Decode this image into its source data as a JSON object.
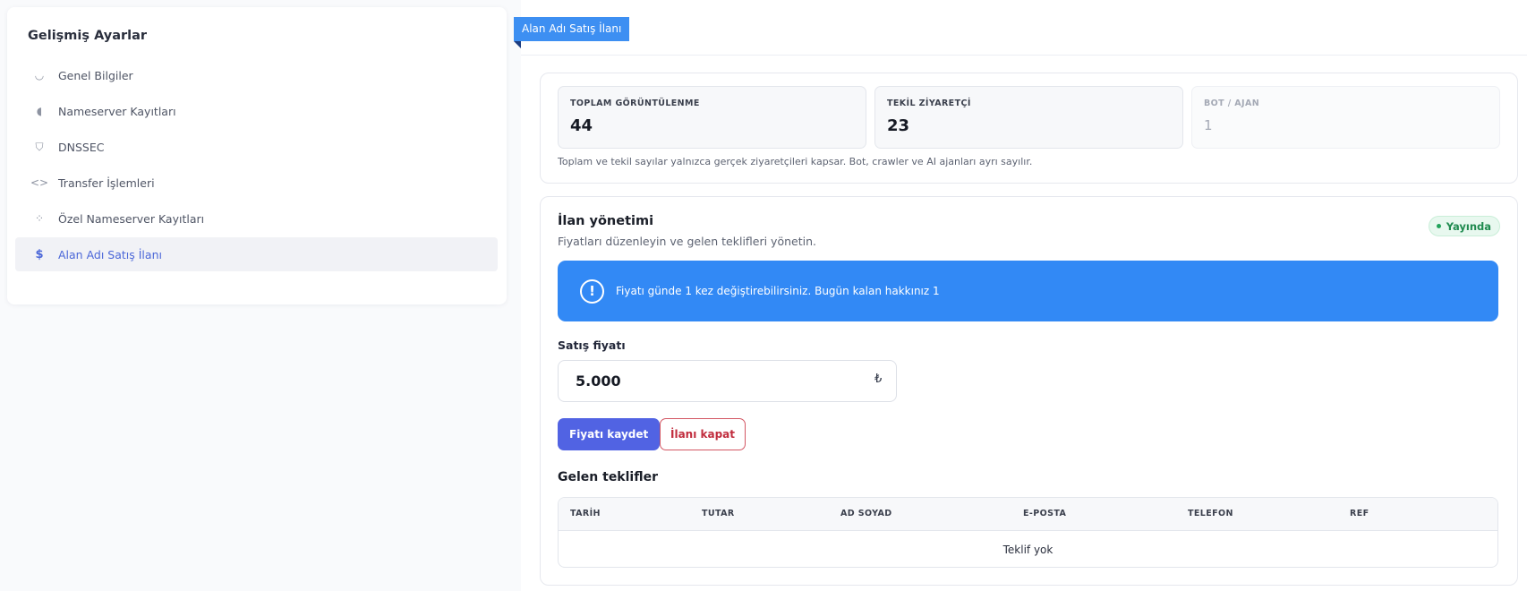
{
  "sidebar": {
    "title": "Gelişmiş Ayarlar",
    "items": [
      {
        "label": "Genel Bilgiler",
        "icon": "info-circle-icon",
        "active": false
      },
      {
        "label": "Nameserver Kayıtları",
        "icon": "server-icon",
        "active": false
      },
      {
        "label": "DNSSEC",
        "icon": "shield-icon",
        "active": false
      },
      {
        "label": "Transfer İşlemleri",
        "icon": "code-icon",
        "active": false
      },
      {
        "label": "Özel Nameserver Kayıtları",
        "icon": "nodes-icon",
        "active": false
      },
      {
        "label": "Alan Adı Satış İlanı",
        "icon": "dollar-icon",
        "active": true
      }
    ],
    "icon_glyphs": [
      "◡",
      "◖",
      "⛉",
      "<>",
      "⁘",
      "$"
    ]
  },
  "ribbon": {
    "label": "Alan Adı Satış İlanı"
  },
  "stats": {
    "items": [
      {
        "label": "TOPLAM GÖRÜNTÜLENME",
        "value": "44"
      },
      {
        "label": "TEKİL ZİYARETÇİ",
        "value": "23"
      },
      {
        "label": "BOT / AJAN",
        "value": "1"
      }
    ],
    "note": "Toplam ve tekil sayılar yalnızca gerçek ziyaretçileri kapsar. Bot, crawler ve AI ajanları ayrı sayılır."
  },
  "manage": {
    "title": "İlan yönetimi",
    "subtitle": "Fiyatları düzenleyin ve gelen teklifleri yönetin.",
    "status": "Yayında",
    "alert": "Fiyatı günde 1 kez değiştirebilirsiniz. Bugün kalan hakkınız 1",
    "alert_icon": "!",
    "price_label": "Satış fiyatı",
    "price_value": "5.000",
    "currency": "₺",
    "save_label": "Fiyatı kaydet",
    "close_label": "İlanı kapat",
    "offers_title": "Gelen teklifler",
    "columns": [
      "TARİH",
      "TUTAR",
      "AD SOYAD",
      "E-POSTA",
      "TELEFON",
      "REF"
    ],
    "empty": "Teklif yok"
  },
  "colors": {
    "accent": "#3289f5",
    "primary_button": "#5163e3",
    "danger": "#c12d3e",
    "success": "#1f8a4f",
    "active_nav": "#4b67d8"
  }
}
